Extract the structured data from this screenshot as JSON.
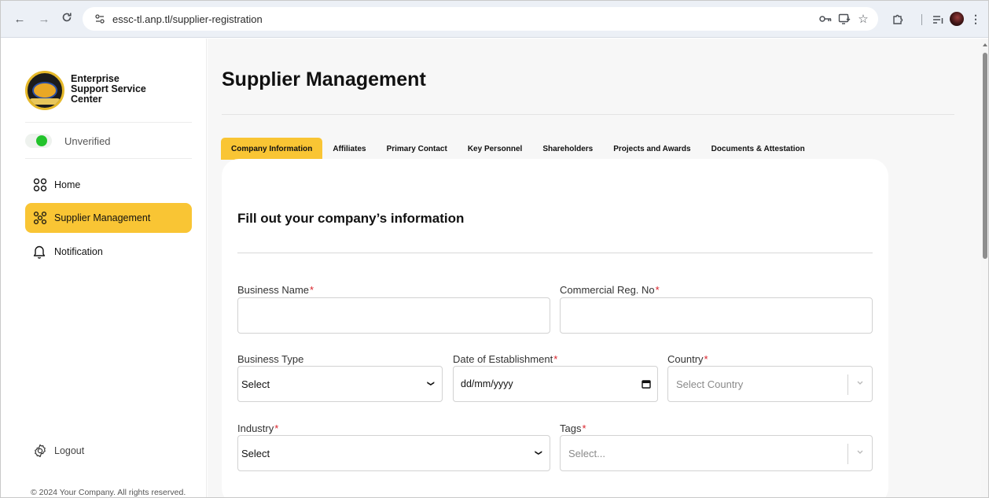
{
  "browser": {
    "url": "essc-tl.anp.tl/supplier-registration",
    "icons": [
      "back-icon",
      "forward-icon",
      "reload-icon",
      "site-settings-icon",
      "password-key-icon",
      "install-app-icon",
      "bookmark-star-icon",
      "extensions-icon",
      "media-queue-icon",
      "profile-avatar",
      "more-options-icon"
    ]
  },
  "brand": {
    "line1": "Enterprise",
    "line2": "Support Service",
    "line3": "Center"
  },
  "sidebar": {
    "status_label": "Unverified",
    "status_on_color": "#22c32b",
    "items": [
      {
        "label": "Home",
        "icon": "grid-icon",
        "active": false
      },
      {
        "label": "Supplier Management",
        "icon": "network-icon",
        "active": true
      },
      {
        "label": "Notification",
        "icon": "bell-icon",
        "active": false
      }
    ],
    "logout_label": "Logout",
    "footer": "© 2024 Your Company. All rights reserved."
  },
  "main": {
    "page_title": "Supplier Management",
    "tabs": [
      {
        "label": "Company Information",
        "active": true
      },
      {
        "label": "Affiliates",
        "active": false
      },
      {
        "label": "Primary Contact",
        "active": false
      },
      {
        "label": "Key Personnel",
        "active": false
      },
      {
        "label": "Shareholders",
        "active": false
      },
      {
        "label": "Projects and Awards",
        "active": false
      },
      {
        "label": "Documents & Attestation",
        "active": false
      }
    ],
    "form": {
      "title": "Fill out your company’s information",
      "business_name": {
        "label": "Business Name",
        "required": "*",
        "value": ""
      },
      "commercial_reg": {
        "label": "Commercial Reg. No",
        "required": "*",
        "value": ""
      },
      "business_type": {
        "label": "Business Type",
        "value": "Select"
      },
      "date_of_establishment": {
        "label": "Date of Establishment",
        "required": "*",
        "placeholder": "dd/mm/yyyy"
      },
      "country": {
        "label": "Country",
        "required": "*",
        "placeholder": "Select Country"
      },
      "industry": {
        "label": "Industry",
        "required": "*",
        "value": "Select"
      },
      "tags": {
        "label": "Tags",
        "required": "*",
        "placeholder": "Select..."
      }
    }
  },
  "theme": {
    "accent": "#f9c534",
    "required": "#d9222a"
  }
}
